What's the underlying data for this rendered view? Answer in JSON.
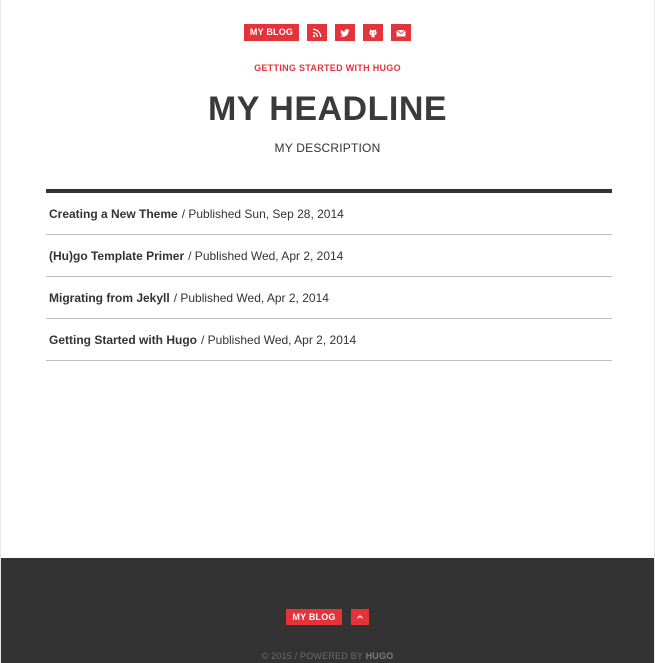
{
  "top_nav": {
    "blog_label": "MY BLOG",
    "icons": [
      "rss-icon",
      "twitter-icon",
      "github-icon",
      "envelope-icon"
    ]
  },
  "header": {
    "kicker": "GETTING STARTED WITH HUGO",
    "headline": "MY HEADLINE",
    "description": "MY DESCRIPTION"
  },
  "posts": [
    {
      "title": "Creating a New Theme",
      "meta": "/ Published Sun, Sep 28, 2014"
    },
    {
      "title": "(Hu)go Template Primer",
      "meta": "/ Published Wed, Apr 2, 2014"
    },
    {
      "title": "Migrating from Jekyll",
      "meta": "/ Published Wed, Apr 2, 2014"
    },
    {
      "title": "Getting Started with Hugo",
      "meta": "/ Published Wed, Apr 2, 2014"
    }
  ],
  "footer": {
    "blog_label": "MY BLOG",
    "up_icon": "chevron-up-icon",
    "copyright": "© 2015 / POWERED BY",
    "powered_by": "HUGO"
  },
  "colors": {
    "accent": "#e5333b",
    "text": "#333333",
    "footer_bg": "#333333"
  }
}
